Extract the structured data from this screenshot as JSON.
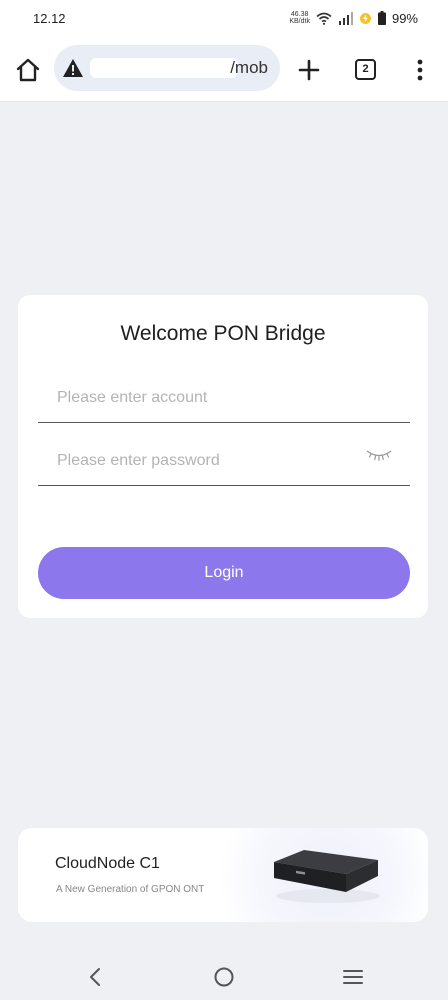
{
  "status_bar": {
    "time": "12.12",
    "net_speed_value": "46.38",
    "net_speed_unit": "KB/dtk",
    "battery": "99%"
  },
  "browser": {
    "url_visible_suffix": "/mob",
    "tab_count": "2"
  },
  "login": {
    "title": "Welcome PON Bridge",
    "account_placeholder": "Please enter account",
    "password_placeholder": "Please enter password",
    "login_label": "Login"
  },
  "promo": {
    "title": "CloudNode C1",
    "subtitle": "A New Generation of GPON ONT"
  },
  "colors": {
    "accent": "#8c78ec",
    "page_bg": "#eff0f4",
    "url_bar_bg": "#e9edf6"
  },
  "icons": {
    "home": "home-icon",
    "warning": "warning-icon",
    "new_tab": "plus-icon",
    "menu": "more-vertical-icon",
    "password_toggle": "eye-closed-icon",
    "nav_back": "chevron-left-icon",
    "nav_home": "circle-home-icon",
    "nav_recents": "menu-lines-icon"
  }
}
